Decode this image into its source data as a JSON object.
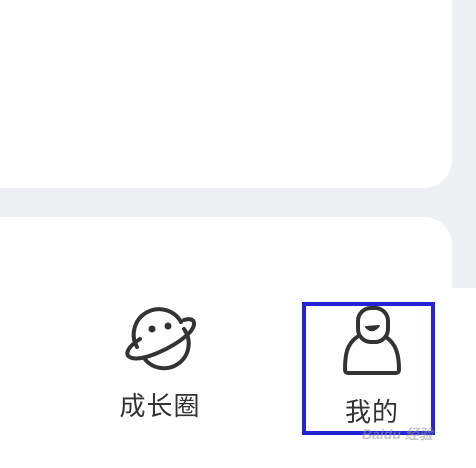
{
  "tabbar": {
    "items": [
      {
        "label": "成长圈",
        "icon": "planet-face-icon"
      },
      {
        "label": "我的",
        "icon": "person-icon"
      }
    ]
  },
  "watermark": {
    "text": "Baidu 经验"
  },
  "colors": {
    "highlight": "#2222d6",
    "icon_stroke": "#333333",
    "background": "#eef0f4"
  }
}
